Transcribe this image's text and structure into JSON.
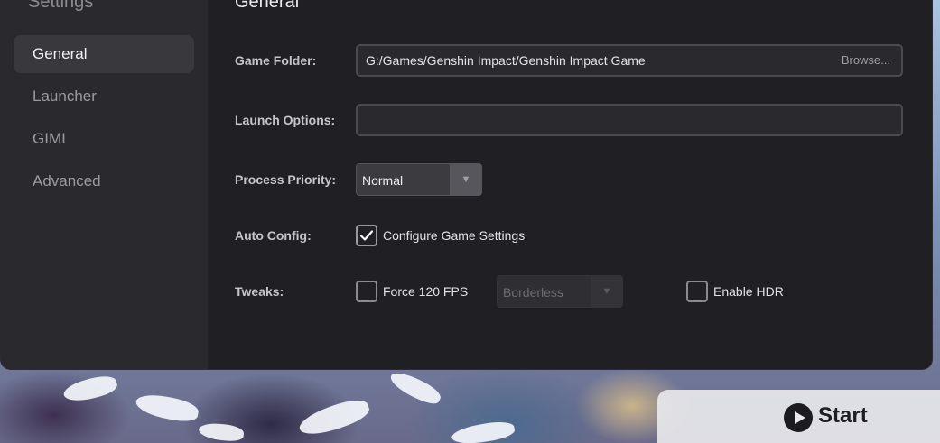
{
  "sidebar": {
    "title": "Settings",
    "items": [
      {
        "label": "General"
      },
      {
        "label": "Launcher"
      },
      {
        "label": "GIMI"
      },
      {
        "label": "Advanced"
      }
    ]
  },
  "main": {
    "title": "General",
    "game_folder": {
      "label": "Game Folder:",
      "value": "G:/Games/Genshin Impact/Genshin Impact Game",
      "browse_label": "Browse..."
    },
    "launch_options": {
      "label": "Launch Options:",
      "value": ""
    },
    "process_priority": {
      "label": "Process Priority:",
      "value": "Normal"
    },
    "auto_config": {
      "label": "Auto Config:",
      "checkbox_label": "Configure Game Settings",
      "checked": true
    },
    "tweaks": {
      "label": "Tweaks:",
      "force_fps_label": "Force 120 FPS",
      "force_fps_checked": false,
      "window_mode_value": "Borderless",
      "hdr_label": "Enable HDR",
      "hdr_checked": false
    }
  },
  "start_button": {
    "label": "Start"
  },
  "icons": {
    "check": "checkmark-icon",
    "dropdown": "dropdown-arrow-icon",
    "play": "play-icon"
  },
  "colors": {
    "window_bg": "#202024",
    "sidebar_bg": "#2a2a2e",
    "active_item_bg": "#38383d"
  }
}
